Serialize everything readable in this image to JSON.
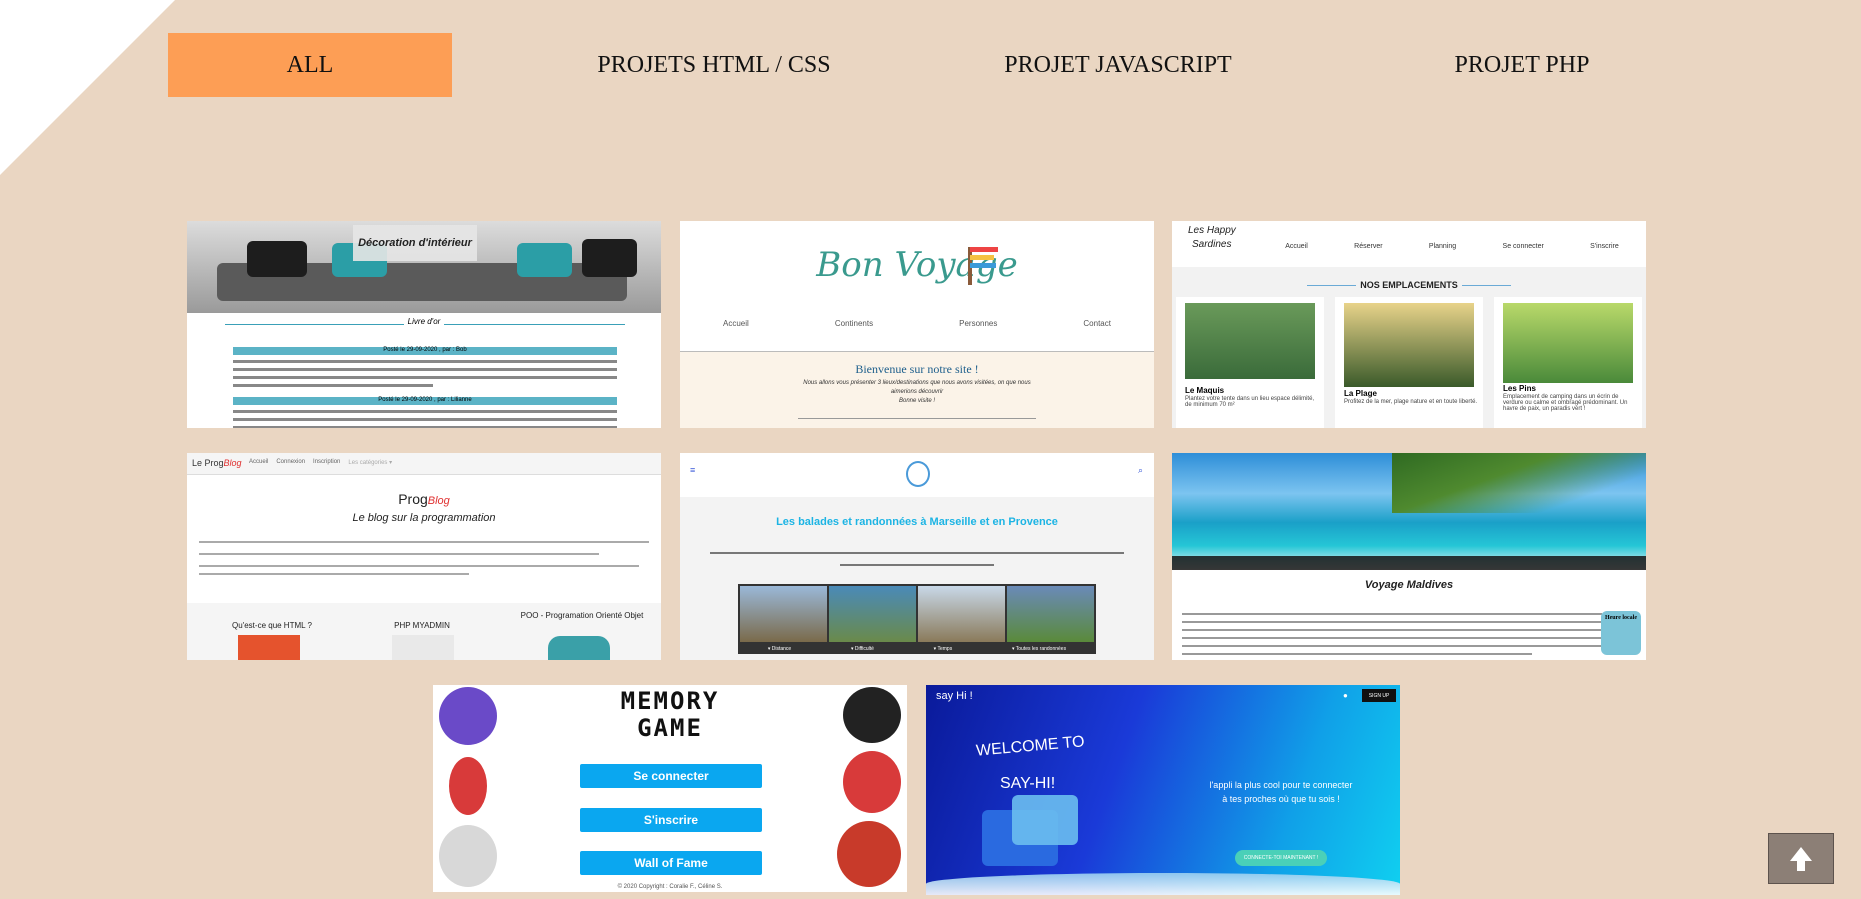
{
  "filters": [
    {
      "label": "ALL",
      "active": true
    },
    {
      "label": "PROJETS HTML / CSS",
      "active": false
    },
    {
      "label": "PROJET JAVASCRIPT",
      "active": false
    },
    {
      "label": "PROJET PHP",
      "active": false
    }
  ],
  "projects": {
    "deco": {
      "banner": "Décoration d'intérieur",
      "subtitle": "Livre d'or",
      "post1": "Posté le 29-09-2020 , par : Bob",
      "post2": "Posté le 29-09-2020 , par : Lilianne"
    },
    "voyage": {
      "logo": "Bon Voyage",
      "nav": [
        "Accueil",
        "Continents",
        "Personnes",
        "Contact"
      ],
      "welcome": "Bienvenue sur notre site !",
      "line1": "Nous allons vous présenter 3 lieux/destinations que nous avons visitées, on que nous",
      "line2": "aimerions découvrir",
      "line3": "Bonne visite !"
    },
    "sardines": {
      "logo1": "Les Happy",
      "logo2": "Sardines",
      "nav": [
        "Accueil",
        "Réserver",
        "Planning",
        "Se connecter",
        "S'inscrire"
      ],
      "section": "NOS EMPLACEMENTS",
      "places": [
        {
          "name": "Le Maquis",
          "desc": "Plantez votre tente dans un lieu espace délimité, de minimum 70 m²"
        },
        {
          "name": "La Plage",
          "desc": "Profitez de la mer, plage nature et en toute liberté."
        },
        {
          "name": "Les Pins",
          "desc": "Emplacement de camping dans un écrin de verdure ou calme et ombragé prédominant. Un havre de paix, un paradis vert !"
        }
      ]
    },
    "blog": {
      "brand": "Le Prog",
      "brand2": "Blog",
      "nav": [
        "Accueil",
        "Connexion",
        "Inscription",
        "Les catégories ▾"
      ],
      "title": "Prog",
      "title2": "Blog",
      "tagline": "Le blog sur la programmation",
      "cats": [
        "Qu'est-ce que HTML ?",
        "PHP MYADMIN",
        "POO - Programation Orienté Objet"
      ]
    },
    "marseille": {
      "title": "Les balades et randonnées à Marseille et en Provence",
      "tabs": [
        "▾ Distance",
        "▾ Difficulté",
        "▾ Temps",
        "▾ Toutes les randonnées"
      ]
    },
    "maldives": {
      "title": "Voyage Maldives",
      "badge": "Heure locale"
    },
    "memory": {
      "title1": "MEMORY",
      "title2": "GAME",
      "buttons": [
        "Se connecter",
        "S'inscrire",
        "Wall of Fame"
      ],
      "footer": "© 2020 Copyright : Coralie F., Céline S."
    },
    "sayhi": {
      "brand": "say Hi !",
      "signup": "SIGN UP",
      "welcome1": "WELCOME TO",
      "welcome2": "SAY-HI!",
      "pitch": "l'appli la plus cool pour te connecter à tes proches où que tu sois !",
      "cta": "CONNECTE-TOI MAINTENANT !"
    }
  },
  "icons": {
    "scroll_top": "arrow-up-icon"
  },
  "colors": {
    "accent": "#fd9e55",
    "background": "#ead6c2"
  }
}
